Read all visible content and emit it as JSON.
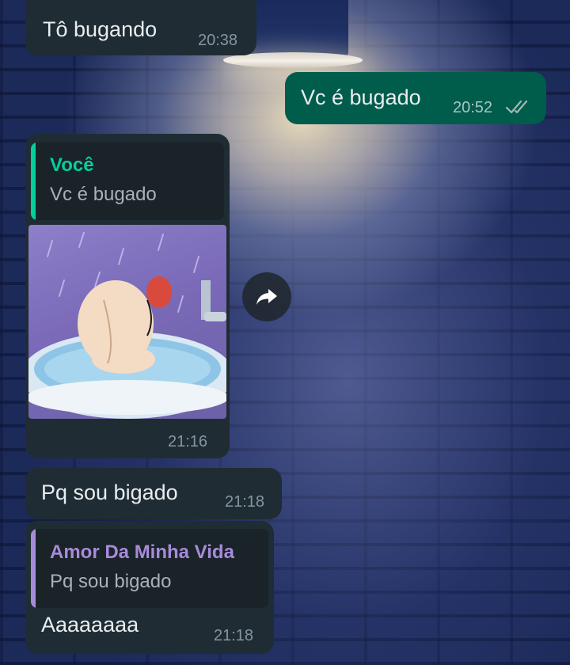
{
  "messages": [
    {
      "id": "m1",
      "direction": "in",
      "text": "Tô bugando",
      "time": "20:38"
    },
    {
      "id": "m2",
      "direction": "out",
      "text": "Vc é bugado",
      "time": "20:52",
      "status": "read"
    },
    {
      "id": "m3",
      "direction": "in",
      "type": "image",
      "quote": {
        "author": "Você",
        "text": "Vc é bugado"
      },
      "time": "21:16"
    },
    {
      "id": "m4",
      "direction": "in",
      "text": "Pq sou bigado",
      "time": "21:18"
    },
    {
      "id": "m5",
      "direction": "in",
      "quote": {
        "author": "Amor Da Minha Vida",
        "text": "Pq sou bigado"
      },
      "text": "Aaaaaaaa",
      "time": "21:18"
    }
  ],
  "colors": {
    "incoming_bubble": "#1f2c33",
    "outgoing_bubble": "#005c4b",
    "quote_author_self": "#06cf9c",
    "quote_author_contact": "#a78bdb",
    "timestamp": "#8696a0"
  },
  "icons": {
    "read_receipt": "double-check-icon",
    "forward": "forward-arrow-icon"
  }
}
